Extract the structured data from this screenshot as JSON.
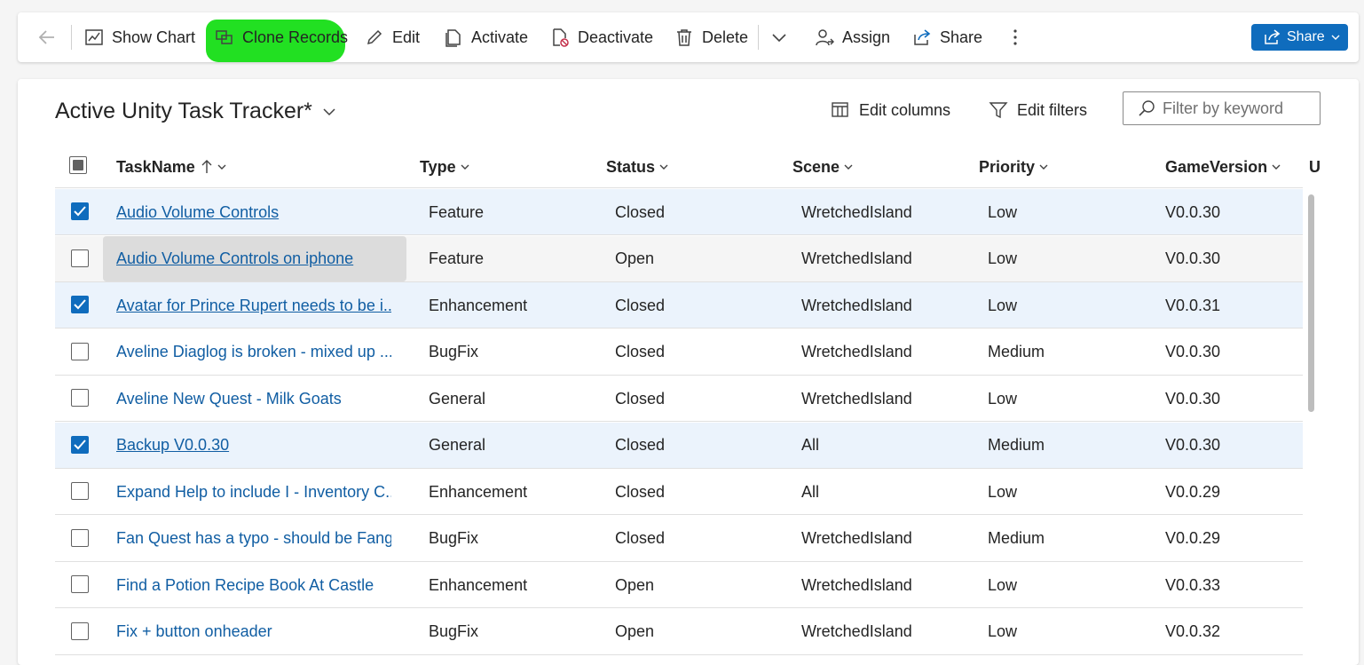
{
  "toolbar": {
    "show_chart": "Show Chart",
    "clone_records": "Clone Records",
    "edit": "Edit",
    "activate": "Activate",
    "deactivate": "Deactivate",
    "delete": "Delete",
    "assign": "Assign",
    "share": "Share",
    "share_primary": "Share"
  },
  "view": {
    "title": "Active Unity Task Tracker*",
    "edit_columns": "Edit columns",
    "edit_filters": "Edit filters",
    "filter_placeholder": "Filter by keyword"
  },
  "columns": {
    "taskname": "TaskName",
    "type": "Type",
    "status": "Status",
    "scene": "Scene",
    "priority": "Priority",
    "gameversion": "GameVersion",
    "partial": "Ur"
  },
  "rows": [
    {
      "name": "Audio Volume Controls",
      "type": "Feature",
      "status": "Closed",
      "scene": "WretchedIsland",
      "priority": "Low",
      "version": "V0.0.30",
      "selected": true,
      "link": true
    },
    {
      "name": "Audio Volume Controls on iphone",
      "type": "Feature",
      "status": "Open",
      "scene": "WretchedIsland",
      "priority": "Low",
      "version": "V0.0.30",
      "selected": false,
      "link": true,
      "hover": true
    },
    {
      "name": "Avatar for Prince Rupert needs to be i...",
      "type": "Enhancement",
      "status": "Closed",
      "scene": "WretchedIsland",
      "priority": "Low",
      "version": "V0.0.31",
      "selected": true,
      "link": true
    },
    {
      "name": "Aveline Diaglog is broken - mixed up ...",
      "type": "BugFix",
      "status": "Closed",
      "scene": "WretchedIsland",
      "priority": "Medium",
      "version": "V0.0.30",
      "selected": false,
      "link": false
    },
    {
      "name": "Aveline New Quest - Milk Goats",
      "type": "General",
      "status": "Closed",
      "scene": "WretchedIsland",
      "priority": "Low",
      "version": "V0.0.30",
      "selected": false,
      "link": false
    },
    {
      "name": "Backup V0.0.30",
      "type": "General",
      "status": "Closed",
      "scene": "All",
      "priority": "Medium",
      "version": "V0.0.30",
      "selected": true,
      "link": true
    },
    {
      "name": "Expand Help to include I - Inventory C...",
      "type": "Enhancement",
      "status": "Closed",
      "scene": "All",
      "priority": "Low",
      "version": "V0.0.29",
      "selected": false,
      "link": false
    },
    {
      "name": "Fan Quest has a typo - should be Fang",
      "type": "BugFix",
      "status": "Closed",
      "scene": "WretchedIsland",
      "priority": "Medium",
      "version": "V0.0.29",
      "selected": false,
      "link": false
    },
    {
      "name": "Find a Potion Recipe Book At Castle",
      "type": "Enhancement",
      "status": "Open",
      "scene": "WretchedIsland",
      "priority": "Low",
      "version": "V0.0.33",
      "selected": false,
      "link": false
    },
    {
      "name": "Fix + button onheader",
      "type": "BugFix",
      "status": "Open",
      "scene": "WretchedIsland",
      "priority": "Low",
      "version": "V0.0.32",
      "selected": false,
      "link": false
    }
  ]
}
